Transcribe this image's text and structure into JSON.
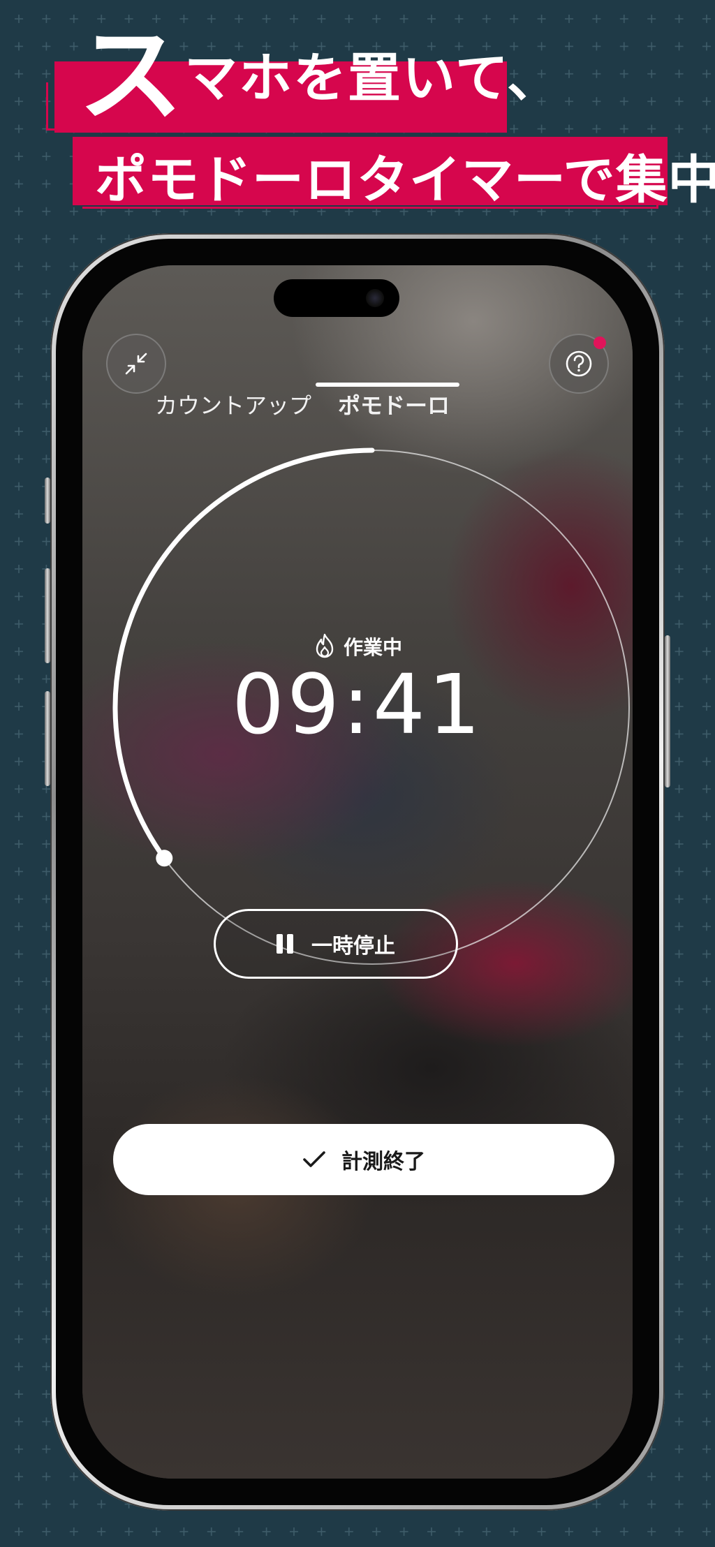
{
  "headline": {
    "line1_big": "ス",
    "line1_rest": "マホを置いて、",
    "line2": "ポモドーロタイマーで集中"
  },
  "colors": {
    "accent": "#d6064d",
    "background": "#0f1f28",
    "notification_dot": "#e0145a"
  },
  "screen": {
    "collapse_icon": "collapse-arrows-icon",
    "help_icon": "question-circle-icon",
    "tabs": [
      {
        "label": "カウントアップ",
        "selected": false
      },
      {
        "label": "ポモドーロ",
        "selected": true
      }
    ],
    "timer": {
      "status_icon": "flame-icon",
      "status": "作業中",
      "time": "09:41",
      "progress": 0.35
    },
    "pause_button": {
      "label": "一時停止",
      "icon": "pause-icon"
    },
    "end_button": {
      "label": "計測終了",
      "icon": "check-icon"
    }
  }
}
